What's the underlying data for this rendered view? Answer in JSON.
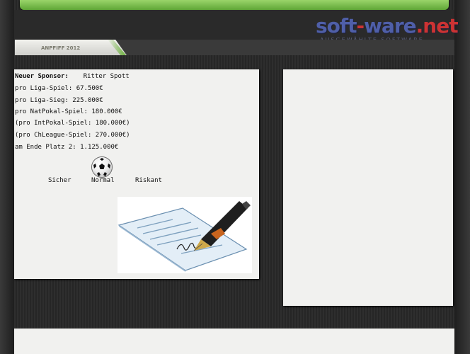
{
  "header": {
    "logo_main": "soft",
    "logo_dash": "-",
    "logo_rest": "ware",
    "logo_tld": ".net",
    "logo_sub": "AUSGEWÄHLTE SOFTWARE",
    "tab_label": "ANPFIFF 2012"
  },
  "sponsor": {
    "heading": "Neuer Sponsor:",
    "name": "Ritter Spott",
    "lines": [
      "pro Liga-Spiel: 67.500€",
      "pro Liga-Sieg: 225.000€",
      "pro NatPokal-Spiel: 180.000€",
      "(pro IntPokal-Spiel: 180.000€)",
      "(pro ChLeague-Spiel: 270.000€)",
      "am Ende Platz 2: 1.125.000€"
    ]
  },
  "risk": {
    "options": [
      "Sicher",
      "Normal",
      "Riskant"
    ],
    "selected": "Normal"
  },
  "icons": {
    "ball": "soccer-ball-icon",
    "contract": "contract-signing-icon"
  },
  "colors": {
    "accent_green": "#6fb33f",
    "logo_blue": "#4f5fa8",
    "panel_bg": "#f1f1ef"
  }
}
